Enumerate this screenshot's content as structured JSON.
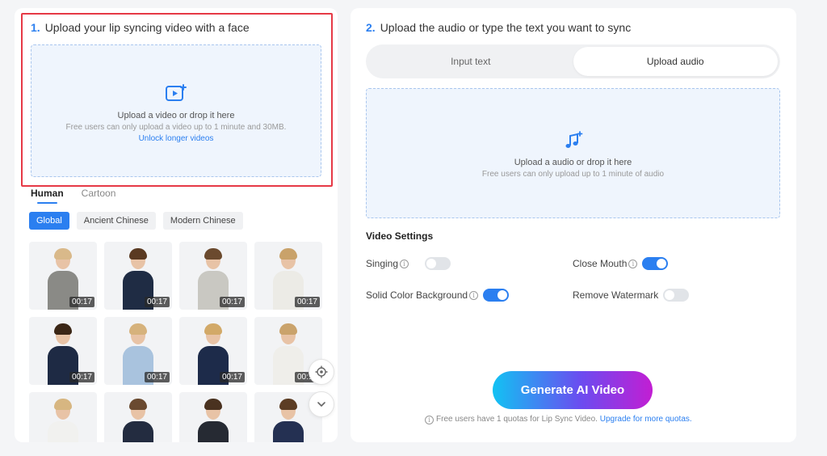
{
  "left": {
    "step_num": "1.",
    "step_title": "Upload your lip syncing video with a face",
    "drop_main": "Upload a video or drop it here",
    "drop_sub": "Free users can only upload a video up to 1 minute and 30MB.",
    "drop_link": "Unlock longer videos",
    "tabs": [
      {
        "label": "Human"
      },
      {
        "label": "Cartoon"
      }
    ],
    "chips": [
      {
        "label": "Global"
      },
      {
        "label": "Ancient Chinese"
      },
      {
        "label": "Modern Chinese"
      }
    ],
    "durations": [
      "00:17",
      "00:17",
      "00:17",
      "00:17",
      "00:17",
      "00:17",
      "00:17",
      "00:17"
    ]
  },
  "right": {
    "step_num": "2.",
    "step_title": "Upload the audio or type the text you want to sync",
    "modes": [
      {
        "label": "Input text"
      },
      {
        "label": "Upload audio"
      }
    ],
    "drop_main": "Upload a audio or drop it here",
    "drop_sub": "Free users can only upload up to 1 minute of audio",
    "settings_title": "Video Settings",
    "settings": {
      "singing": {
        "label": "Singing",
        "on": false
      },
      "close_mouth": {
        "label": "Close Mouth",
        "on": true
      },
      "solid_bg": {
        "label": "Solid Color Background",
        "on": true
      },
      "remove_watermark": {
        "label": "Remove Watermark",
        "on": false
      }
    },
    "generate_label": "Generate AI Video",
    "quota_text": "Free users have 1 quotas for Lip Sync Video.",
    "quota_link": "Upgrade for more quotas."
  },
  "colors": {
    "accent": "#2b7ff0",
    "highlight": "#e63946"
  }
}
